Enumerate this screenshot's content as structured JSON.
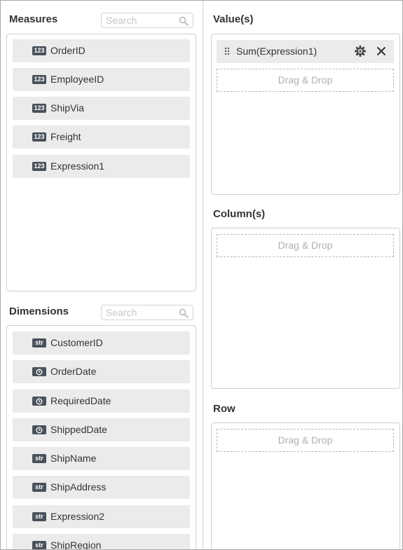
{
  "measures": {
    "title": "Measures",
    "search_placeholder": "Search",
    "items": [
      {
        "type": "123",
        "label": "OrderID"
      },
      {
        "type": "123",
        "label": "EmployeeID"
      },
      {
        "type": "123",
        "label": "ShipVia"
      },
      {
        "type": "123",
        "label": "Freight"
      },
      {
        "type": "123",
        "label": "Expression1"
      }
    ]
  },
  "dimensions": {
    "title": "Dimensions",
    "search_placeholder": "Search",
    "items": [
      {
        "type": "str",
        "label": "CustomerID"
      },
      {
        "type": "clock-icon",
        "label": "OrderDate"
      },
      {
        "type": "clock-icon",
        "label": "RequiredDate"
      },
      {
        "type": "clock-icon",
        "label": "ShippedDate"
      },
      {
        "type": "str",
        "label": "ShipName"
      },
      {
        "type": "str",
        "label": "ShipAddress"
      },
      {
        "type": "str",
        "label": "Expression2"
      },
      {
        "type": "str",
        "label": "ShipRegion"
      }
    ]
  },
  "values": {
    "title": "Value(s)",
    "chip_label": "Sum(Expression1)",
    "drop_label": "Drag & Drop"
  },
  "columns": {
    "title": "Column(s)",
    "drop_label": "Drag & Drop"
  },
  "rows": {
    "title": "Row",
    "drop_label": "Drag & Drop"
  },
  "icons": {
    "search": "search-icon",
    "settings": "gear-icon",
    "remove": "close-icon",
    "drag": "drag-handle-icon",
    "date": "clock-icon"
  }
}
